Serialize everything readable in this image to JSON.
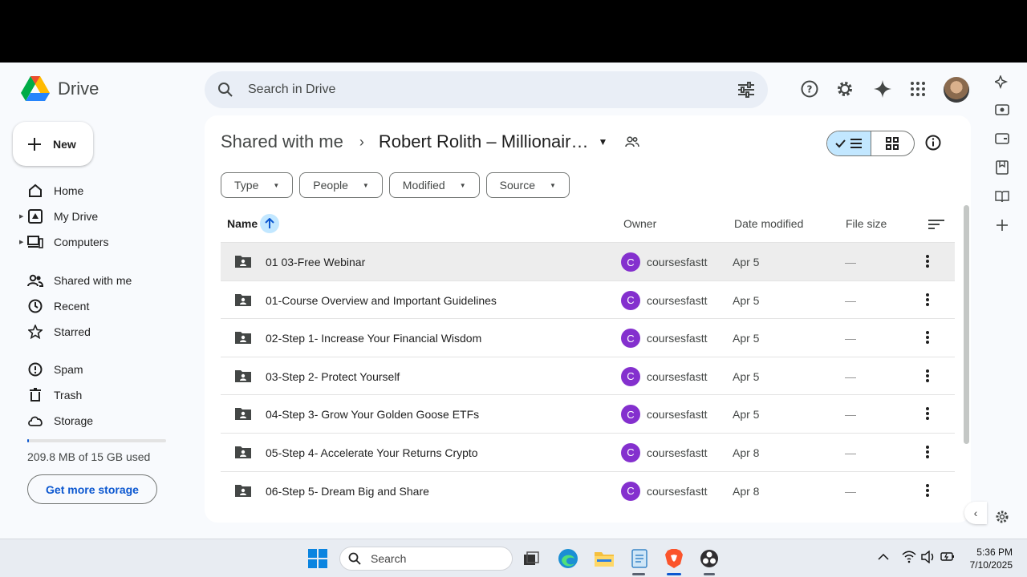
{
  "app": {
    "name": "Drive"
  },
  "search": {
    "placeholder": "Search in Drive"
  },
  "sidebar": {
    "new_label": "New",
    "groups": [
      [
        {
          "label": "Home",
          "icon": "home-icon",
          "caret": false
        },
        {
          "label": "My Drive",
          "icon": "my-drive-icon",
          "caret": true
        },
        {
          "label": "Computers",
          "icon": "computers-icon",
          "caret": true
        }
      ],
      [
        {
          "label": "Shared with me",
          "icon": "people-icon",
          "caret": false
        },
        {
          "label": "Recent",
          "icon": "clock-icon",
          "caret": false
        },
        {
          "label": "Starred",
          "icon": "star-icon",
          "caret": false
        }
      ],
      [
        {
          "label": "Spam",
          "icon": "spam-icon",
          "caret": false
        },
        {
          "label": "Trash",
          "icon": "trash-icon",
          "caret": false
        },
        {
          "label": "Storage",
          "icon": "cloud-icon",
          "caret": false
        }
      ]
    ],
    "storage_text": "209.8 MB of 15 GB used",
    "storage_fraction": 0.014,
    "get_more_storage": "Get more storage"
  },
  "breadcrumb": {
    "parent": "Shared with me",
    "current": "Robert Rolith – Millionair…"
  },
  "filters": [
    "Type",
    "People",
    "Modified",
    "Source"
  ],
  "table": {
    "columns": {
      "name": "Name",
      "owner": "Owner",
      "date": "Date modified",
      "size": "File size"
    },
    "rows": [
      {
        "name": "01 03-Free Webinar",
        "owner_initial": "C",
        "owner": "coursesfastt",
        "date": "Apr 5",
        "size": "—"
      },
      {
        "name": "01-Course Overview and Important Guidelines",
        "owner_initial": "C",
        "owner": "coursesfastt",
        "date": "Apr 5",
        "size": "—"
      },
      {
        "name": "02-Step 1- Increase Your Financial Wisdom",
        "owner_initial": "C",
        "owner": "coursesfastt",
        "date": "Apr 5",
        "size": "—"
      },
      {
        "name": "03-Step 2- Protect Yourself",
        "owner_initial": "C",
        "owner": "coursesfastt",
        "date": "Apr 5",
        "size": "—"
      },
      {
        "name": "04-Step 3- Grow Your Golden Goose ETFs",
        "owner_initial": "C",
        "owner": "coursesfastt",
        "date": "Apr 5",
        "size": "—"
      },
      {
        "name": "05-Step 4- Accelerate Your Returns Crypto",
        "owner_initial": "C",
        "owner": "coursesfastt",
        "date": "Apr 8",
        "size": "—"
      },
      {
        "name": "06-Step 5- Dream Big and Share",
        "owner_initial": "C",
        "owner": "coursesfastt",
        "date": "Apr 8",
        "size": "—"
      }
    ]
  },
  "taskbar": {
    "search_label": "Search",
    "time": "5:36 PM",
    "date": "7/10/2025"
  },
  "colors": {
    "accent": "#0b57d0",
    "selected_chip": "#c2e7ff",
    "owner_avatar": "#8430ce"
  }
}
